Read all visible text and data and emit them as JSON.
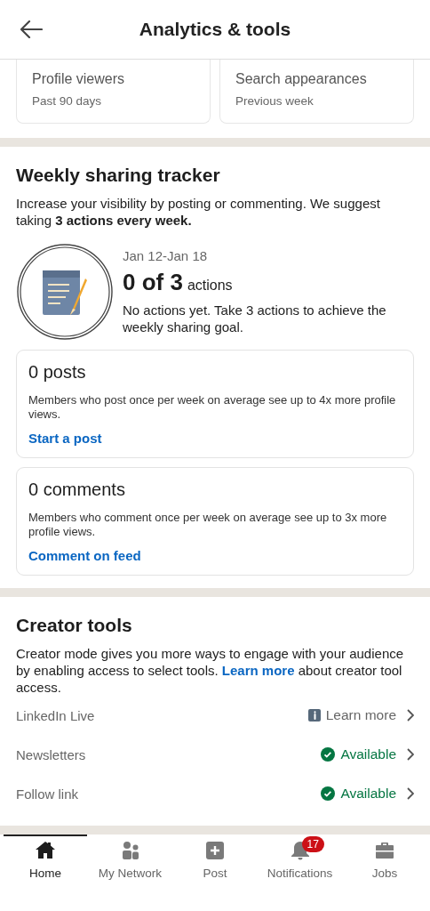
{
  "header": {
    "title": "Analytics & tools"
  },
  "stats": [
    {
      "label": "Profile viewers",
      "period": "Past 90 days"
    },
    {
      "label": "Search appearances",
      "period": "Previous week"
    }
  ],
  "tracker": {
    "title": "Weekly sharing tracker",
    "intro": "Increase your visibility by posting or commenting. We suggest taking **3 actions every week.**",
    "dates": "Jan 12-Jan 18",
    "count": "0 of 3",
    "unit": "actions",
    "message": "No actions yet. Take 3 actions to achieve the weekly sharing goal.",
    "cards": [
      {
        "count": "0 posts",
        "text": "Members who post once per week on average see up to 4x more profile views.",
        "link": "Start a post"
      },
      {
        "count": "0 comments",
        "text": "Members who comment once per week on average see up to 3x more profile views.",
        "link": "Comment on feed"
      }
    ]
  },
  "creator_tools": {
    "title": "Creator tools",
    "text_before": "Creator mode gives you more ways to engage with your audience by enabling access to select tools.",
    "link": "Learn more",
    "text_after": "about creator tool access.",
    "rows": [
      {
        "name": "LinkedIn Live",
        "kind": "info",
        "status": "Learn more"
      },
      {
        "name": "Newsletters",
        "kind": "available",
        "status": "Available"
      },
      {
        "name": "Follow link",
        "kind": "available",
        "status": "Available"
      }
    ]
  },
  "nav": [
    {
      "label": "Home",
      "kind": "home",
      "selected": true
    },
    {
      "label": "My Network",
      "kind": "network",
      "selected": false
    },
    {
      "label": "Post",
      "kind": "post",
      "selected": false
    },
    {
      "label": "Notifications",
      "kind": "bell",
      "selected": false,
      "badge": "17"
    },
    {
      "label": "Jobs",
      "kind": "jobs",
      "selected": false
    }
  ]
}
